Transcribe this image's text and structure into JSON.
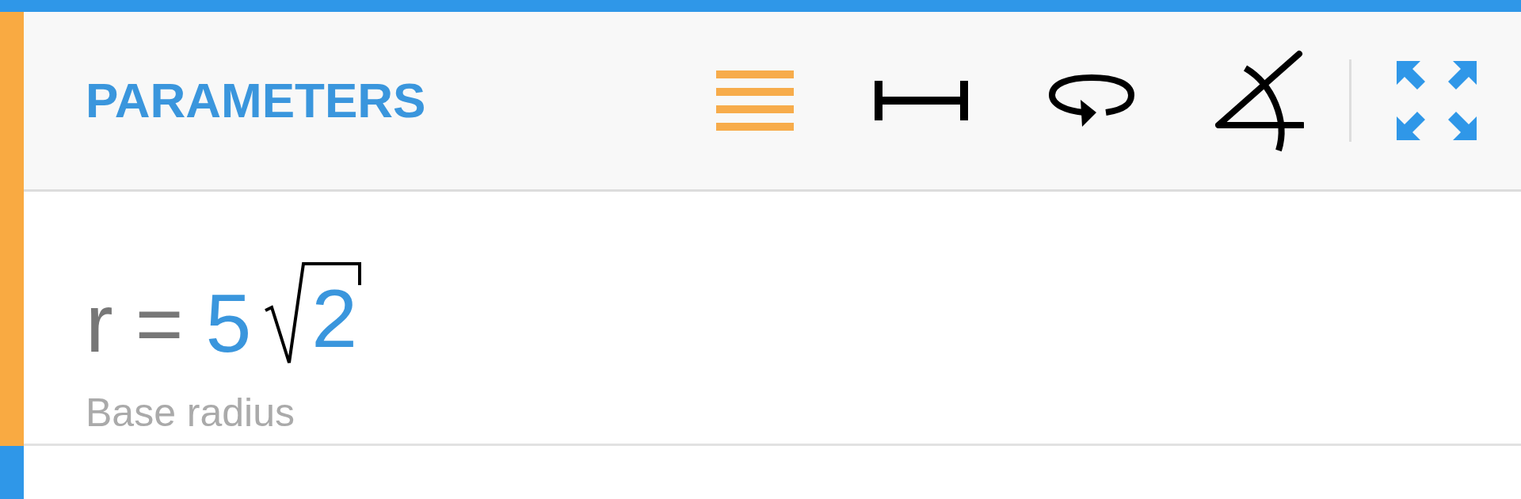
{
  "header": {
    "title": "PARAMETERS",
    "tools": [
      {
        "kind": "list",
        "selected": true
      },
      {
        "kind": "length",
        "selected": false
      },
      {
        "kind": "rotation",
        "selected": false
      },
      {
        "kind": "angle",
        "selected": false
      }
    ]
  },
  "parameter": {
    "variable": "r",
    "operator": "=",
    "coefficient": "5",
    "radicand": "2",
    "description": "Base radius"
  }
}
